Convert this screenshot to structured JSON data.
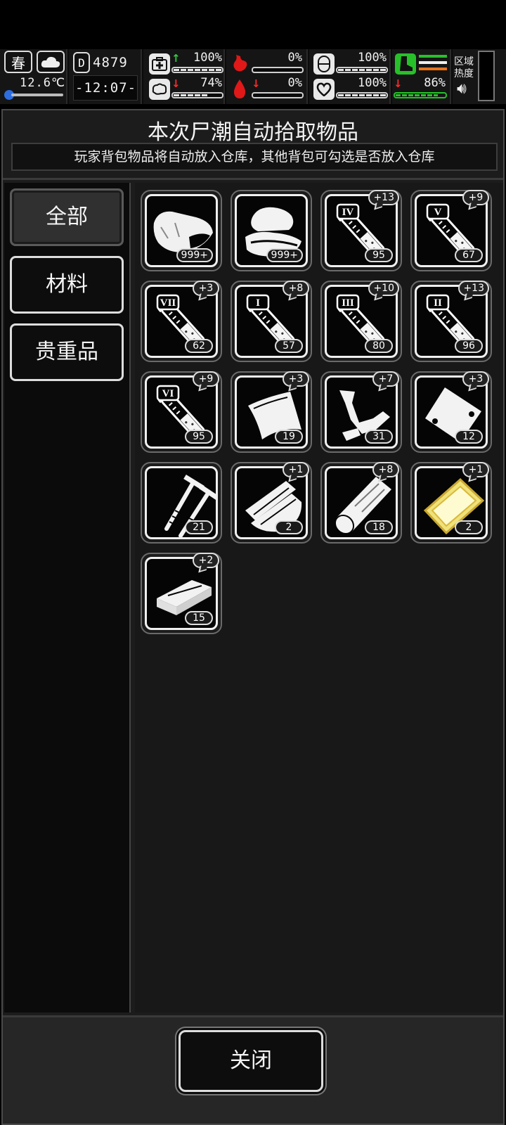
{
  "status": {
    "season": "春",
    "temperature": "12.6℃",
    "day": "4879",
    "time": "-12:07-",
    "health": "100%",
    "stamina": "74%",
    "hunger": "0%",
    "thirst": "0%",
    "mood": "100%",
    "heart": "100%",
    "energy": "86%",
    "region_heat_label": "区域\n热度",
    "colors": {
      "up_arrow": "#2ecc40",
      "down_arrow": "#ff2a2a",
      "energy_green": "#27c02a",
      "orange": "#e8741a"
    }
  },
  "panel": {
    "title": "本次尸潮自动拾取物品",
    "subtitle": "玩家背包物品将自动放入仓库，其他背包可勾选是否放入仓库"
  },
  "categories": [
    {
      "label": "全部",
      "active": true
    },
    {
      "label": "材料",
      "active": false
    },
    {
      "label": "贵重品",
      "active": false
    }
  ],
  "items": [
    {
      "icon": "rock-bundle-icon",
      "qty": "999+",
      "bonus": ""
    },
    {
      "icon": "cloth-stack-icon",
      "qty": "999+",
      "bonus": ""
    },
    {
      "icon": "syringe-iv-icon",
      "tier": "IV",
      "qty": "95",
      "bonus": "+13"
    },
    {
      "icon": "syringe-v-icon",
      "tier": "V",
      "qty": "67",
      "bonus": "+9"
    },
    {
      "icon": "syringe-vii-icon",
      "tier": "VII",
      "qty": "62",
      "bonus": "+3"
    },
    {
      "icon": "syringe-i-icon",
      "tier": "I",
      "qty": "57",
      "bonus": "+8"
    },
    {
      "icon": "syringe-iii-icon",
      "tier": "III",
      "qty": "80",
      "bonus": "+10"
    },
    {
      "icon": "syringe-ii-icon",
      "tier": "II",
      "qty": "96",
      "bonus": "+13"
    },
    {
      "icon": "syringe-vi-icon",
      "tier": "VI",
      "qty": "95",
      "bonus": "+9"
    },
    {
      "icon": "cloth-sheet-icon",
      "qty": "19",
      "bonus": "+3"
    },
    {
      "icon": "scrap-parts-icon",
      "qty": "31",
      "bonus": "+7"
    },
    {
      "icon": "plastic-bag-icon",
      "qty": "12",
      "bonus": "+3"
    },
    {
      "icon": "nails-icon",
      "qty": "21",
      "bonus": ""
    },
    {
      "icon": "wood-planks-icon",
      "qty": "2",
      "bonus": "+1"
    },
    {
      "icon": "log-icon",
      "qty": "18",
      "bonus": "+8"
    },
    {
      "icon": "gold-bar-icon",
      "qty": "2",
      "bonus": "+1"
    },
    {
      "icon": "wood-block-icon",
      "qty": "15",
      "bonus": "+2"
    }
  ],
  "footer": {
    "close_label": "关闭"
  }
}
